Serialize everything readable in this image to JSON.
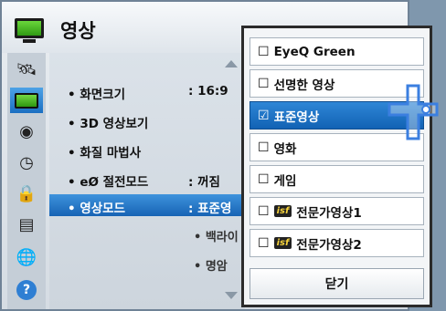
{
  "header": {
    "title": "영상"
  },
  "categories": [
    {
      "icon": "satellite-icon",
      "glyph": "🛰"
    },
    {
      "icon": "tv-picture-icon",
      "glyph": ""
    },
    {
      "icon": "speaker-icon",
      "glyph": "◉"
    },
    {
      "icon": "clock-icon",
      "glyph": "◷"
    },
    {
      "icon": "lock-icon",
      "glyph": "🔒"
    },
    {
      "icon": "toolbox-icon",
      "glyph": "▤"
    },
    {
      "icon": "globe-icon",
      "glyph": "🌐"
    },
    {
      "icon": "help-icon",
      "glyph": "?"
    }
  ],
  "settings": {
    "rows": [
      {
        "label": "• 화면크기",
        "value": ": 16:9"
      },
      {
        "label": "• 3D 영상보기",
        "value": ""
      },
      {
        "label": "• 화질 마법사",
        "value": ""
      },
      {
        "label": "• eØ 절전모드",
        "value": ": 꺼짐"
      },
      {
        "label": "• 영상모드",
        "value": ": 표준영"
      }
    ],
    "sub_values": [
      "• 백라이",
      "• 명암"
    ]
  },
  "popup": {
    "options": [
      {
        "check": "☐",
        "label": "EyeQ Green",
        "isf": ""
      },
      {
        "check": "☐",
        "label": "선명한 영상",
        "isf": ""
      },
      {
        "check": "☑",
        "label": "표준영상",
        "isf": ""
      },
      {
        "check": "☐",
        "label": "영화",
        "isf": ""
      },
      {
        "check": "☐",
        "label": "게임",
        "isf": ""
      },
      {
        "check": "☐",
        "label": "전문가영상1",
        "isf": "isf"
      },
      {
        "check": "☐",
        "label": "전문가영상2",
        "isf": "isf"
      }
    ],
    "close_label": "닫기"
  },
  "colors": {
    "selection_blue": "#1b6fc2",
    "background": "#7f97ad"
  }
}
